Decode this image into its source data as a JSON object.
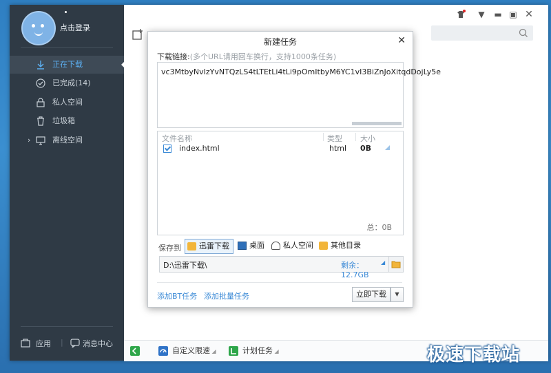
{
  "user": {
    "login_label": "点击登录"
  },
  "sidebar": {
    "items": [
      {
        "label": "正在下载"
      },
      {
        "label": "已完成(14)"
      },
      {
        "label": "私人空间"
      },
      {
        "label": "垃圾箱"
      },
      {
        "label": "离线空间"
      }
    ],
    "bottom": {
      "apps_label": "应用",
      "messages_label": "消息中心"
    }
  },
  "statusbar": {
    "speed_label": "自定义限速",
    "schedule_label": "计划任务"
  },
  "dialog": {
    "title": "新建任务",
    "url_label": "下载链接:",
    "url_hint": "(多个URL请用回车换行，支持1000条任务)",
    "url_value": "vc3MtbyNvIzYvNTQzLS4tLTEtLi4tLi9pOmItbyM6YC1vI3BiZnJoXitqdDojLy5e",
    "table": {
      "headers": [
        "文件名称",
        "类型",
        "大小"
      ],
      "rows": [
        {
          "name": "index.html",
          "type": "html",
          "size": "0B",
          "checked": true
        }
      ],
      "total": "总：0B"
    },
    "save_label": "保存到",
    "locations": [
      {
        "label": "迅雷下载",
        "selected": true
      },
      {
        "label": "桌面"
      },
      {
        "label": "私人空间"
      },
      {
        "label": "其他目录"
      }
    ],
    "path": "D:\\迅雷下载\\",
    "free_space": "剩余：12.7GB",
    "bt_link": "添加BT任务",
    "batch_link": "添加批量任务",
    "download_button": "立即下载"
  },
  "watermark": "极速下载站",
  "colors": {
    "accent": "#3a89d6",
    "sidebar_bg": "#2f3a45",
    "active_text": "#5cb0f2"
  }
}
